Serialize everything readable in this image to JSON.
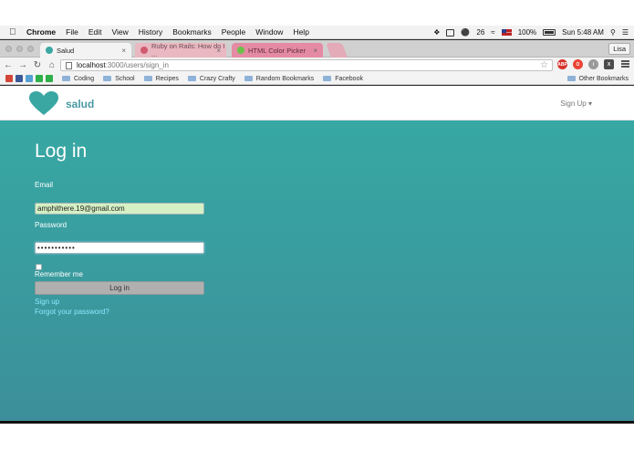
{
  "menubar": {
    "apple": "",
    "items": [
      "Chrome",
      "File",
      "Edit",
      "View",
      "History",
      "Bookmarks",
      "People",
      "Window",
      "Help"
    ],
    "notification_count": "26",
    "battery": "100%",
    "clock": "Sun 5:48 AM"
  },
  "tabs": [
    {
      "label": "Salud",
      "color": "#3aa7a3"
    },
    {
      "label": "Ruby on Rails: How do I ...",
      "color": "#d05b6f"
    },
    {
      "label": "HTML Color Picker",
      "color": "#6cc04a"
    }
  ],
  "profile": "Lisa",
  "omnibox": {
    "host": "localhost",
    "path": ":3000/users/sign_in"
  },
  "extensions": [
    "ABP",
    "O",
    "i",
    "X"
  ],
  "bookmarks": {
    "folders": [
      "Coding",
      "School",
      "Recipes",
      "Crazy Crafty",
      "Random Bookmarks",
      "Facebook"
    ],
    "other": "Other Bookmarks"
  },
  "site": {
    "brand": "salud",
    "signup_menu": "Sign Up ▾",
    "accent": "#4a9aa3"
  },
  "form": {
    "title": "Log in",
    "email_label": "Email",
    "email_value": "amphithere.19@gmail.com",
    "password_label": "Password",
    "password_value": "•••••••••••",
    "remember_label": "Remember me",
    "submit_label": "Log in",
    "signup_link": "Sign up",
    "forgot_link": "Forgot your password?"
  }
}
